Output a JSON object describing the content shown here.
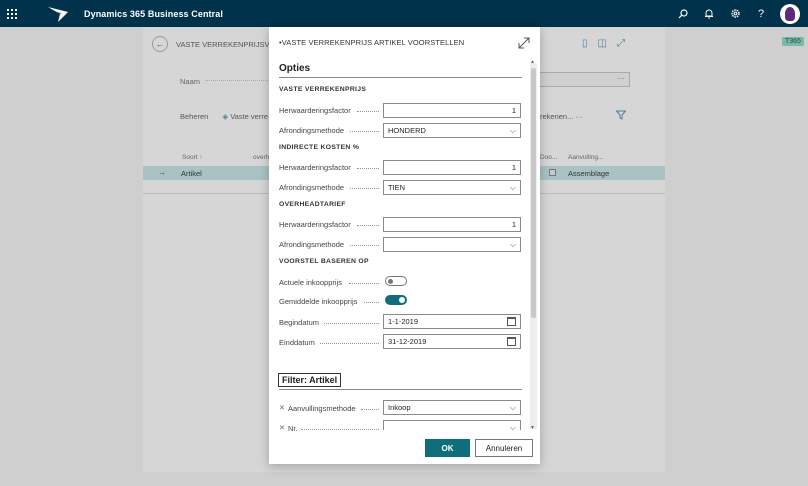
{
  "app": {
    "title": "Dynamics 365 Business Central"
  },
  "topbar": {
    "icons": [
      "search-icon",
      "bell-icon",
      "gear-icon",
      "help-icon"
    ]
  },
  "background": {
    "page_title": "VASTE VERREKENPRIJSVO",
    "naam_label": "Naam",
    "naam_value": "···",
    "actions": [
      "Beheren",
      "Vaste verre"
    ],
    "actions_right": "rekenen...   ···",
    "columns": {
      "sort": "Soort ↑",
      "overh": "overh",
      "doo": "Doo...",
      "aanv": "Aanvulling..."
    },
    "row": {
      "arrow": "→",
      "soort": "Artikel",
      "aanvulling": "Assemblage"
    },
    "badge": "T365"
  },
  "modal": {
    "title": "•VASTE VERREKENPRIJS ARTIKEL VOORSTELLEN",
    "opties": "Opties",
    "groups": {
      "vaste": "VASTE VERREKENPRIJS",
      "indirecte": "INDIRECTE KOSTEN %",
      "overhead": "OVERHEADTARIEF",
      "voorstel": "VOORSTEL BASEREN OP"
    },
    "labels": {
      "herwaardering": "Herwaarderingsfactor",
      "afronding": "Afrondingsmethode",
      "actuele": "Actuele inkoopprijs",
      "gemiddelde": "Gemiddelde inkoopprijs",
      "begindatum": "Begindatum",
      "einddatum": "Einddatum",
      "aanvulling": "Aanvullingsmethode",
      "nr": "Nr."
    },
    "values": {
      "vaste_factor": "1",
      "vaste_afronding": "HONDERD",
      "indirecte_factor": "1",
      "indirecte_afronding": "TIEN",
      "overhead_factor": "1",
      "overhead_afronding": "",
      "actuele_on": false,
      "gemiddelde_on": true,
      "begindatum": "1-1-2019",
      "einddatum": "31-12-2019",
      "aanvulling": "Inkoop",
      "nr": ""
    },
    "filter_title": "Filter: Artikel",
    "ok": "OK",
    "cancel": "Annuleren"
  }
}
